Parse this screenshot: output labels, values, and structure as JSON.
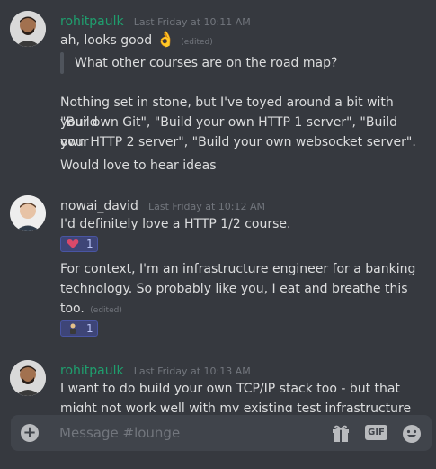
{
  "messages": [
    {
      "author": "rohitpaulk",
      "timestamp": "Last Friday at 10:11 AM",
      "lines": {
        "l1": "ah, looks good",
        "emoji": "👌",
        "edited": "(edited)",
        "quote": "What other courses are on the road map?",
        "p1": "Nothing set in stone, but I've toyed around a bit with \"Build",
        "p2": "your own Git\", \"Build your own HTTP 1 server\", \"Build your",
        "p3": "own HTTP 2 server\", \"Build your own websocket server\".",
        "p4": "Would love to hear ideas"
      }
    },
    {
      "author": "nowai_david",
      "timestamp": "Last Friday at 10:12 AM",
      "lines": {
        "l1": "I'd definitely love a HTTP 1/2 course.",
        "p1": "For context, I'm an infrastructure engineer for a banking",
        "p2": "technology. So probably like you, I eat and breathe this",
        "p3": "too.",
        "edited": "(edited)"
      },
      "reactions": [
        {
          "icon": "heart-eyes-emoji-icon",
          "count": "1"
        },
        {
          "icon": "person-emoji-icon",
          "count": "1"
        }
      ]
    },
    {
      "author": "rohitpaulk",
      "timestamp": "Last Friday at 10:13 AM",
      "lines": {
        "l1": "I want to do build your own TCP/IP stack too - but that",
        "l2": "might not work well with my existing test infrastructure"
      }
    }
  ],
  "composer": {
    "placeholder": "Message #lounge",
    "gif_label": "GIF"
  },
  "colors": {
    "background": "#36393f",
    "composer_bg": "#40444b",
    "author_green": "#1f9f6e"
  }
}
